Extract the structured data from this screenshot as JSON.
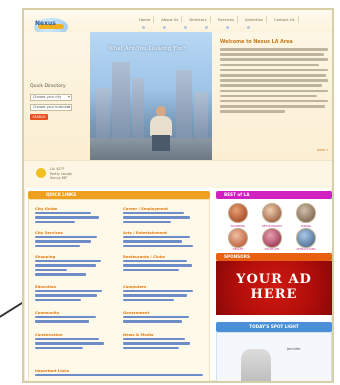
{
  "header": {
    "logo_text": "Nexus",
    "tagline": "Business Directory for the LA Area",
    "nav": [
      "Home",
      "About Us",
      "Directory",
      "Services",
      "Advertise",
      "Contact Us"
    ]
  },
  "search": {
    "title": "Quick Directory",
    "city_placeholder": "Choose your city",
    "business_placeholder": "Choose your business",
    "search_label": "SEARCH"
  },
  "hero": {
    "headline": "What Are You Looking For?"
  },
  "welcome": {
    "title": "Welcome to Nexus LA Area",
    "more_label": "more »"
  },
  "weather": {
    "temp": "LA: 62°F",
    "sub": "Partly cloudy",
    "extra": "Sunny 88°"
  },
  "quick_links": {
    "title": "QUICK LINKS",
    "categories": [
      {
        "name": "City Guide",
        "col": 0
      },
      {
        "name": "Career / Employment",
        "col": 1
      },
      {
        "name": "City Services",
        "col": 0
      },
      {
        "name": "Arts / Entertainment",
        "col": 1
      },
      {
        "name": "Shopping",
        "col": 0
      },
      {
        "name": "Restaurants / Clubs",
        "col": 1
      },
      {
        "name": "Education",
        "col": 0
      },
      {
        "name": "Computers",
        "col": 1
      },
      {
        "name": "Community",
        "col": 0
      },
      {
        "name": "Government",
        "col": 1
      },
      {
        "name": "Construction",
        "col": 0
      },
      {
        "name": "News & Media",
        "col": 1
      }
    ],
    "important_title": "Important Links"
  },
  "best_of": {
    "title": "BEST of LA",
    "items": [
      "SHOPPING",
      "RESTAURANTS",
      "DINING",
      "HEALTH",
      "NIGHTLIFE",
      "ATTRACTIONS"
    ]
  },
  "sponsors": {
    "title": "SPONSORS",
    "ad_line1": "YOUR AD",
    "ad_line2": "HERE"
  },
  "spotlight": {
    "title": "TODAY'S SPOT LIGHT",
    "name": "Jennifer"
  }
}
